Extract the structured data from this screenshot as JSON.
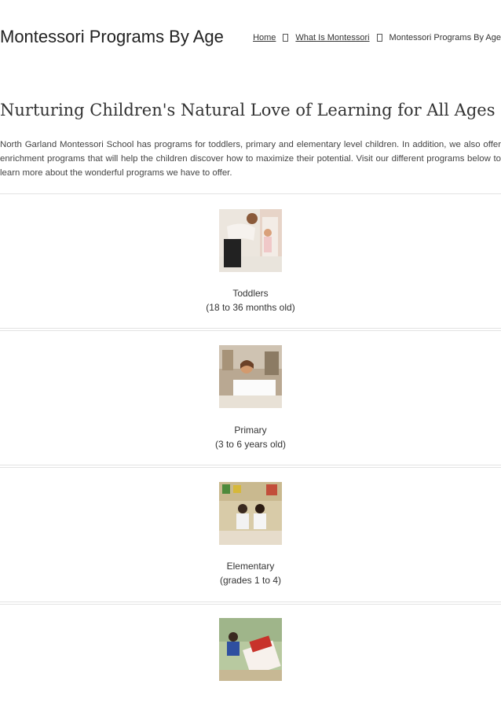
{
  "header": {
    "site_title": "Montessori Programs By Age",
    "breadcrumb": {
      "home": "Home",
      "what_is": "What Is Montessori",
      "current": "Montessori Programs By Age"
    }
  },
  "main": {
    "heading": "Nurturing Children's Natural Love of Learning for All Ages",
    "intro": "North Garland Montessori School has programs for toddlers, primary and elementary level children. In addition, we also offer enrichment programs that will help the children discover how to maximize their potential. Visit our different programs below to learn more about the wonderful programs we have to offer."
  },
  "programs": [
    {
      "name": "Toddlers",
      "age": "(18 to 36 months old)"
    },
    {
      "name": "Primary",
      "age": "(3 to 6 years old)"
    },
    {
      "name": "Elementary",
      "age": "(grades 1 to 4)"
    }
  ]
}
